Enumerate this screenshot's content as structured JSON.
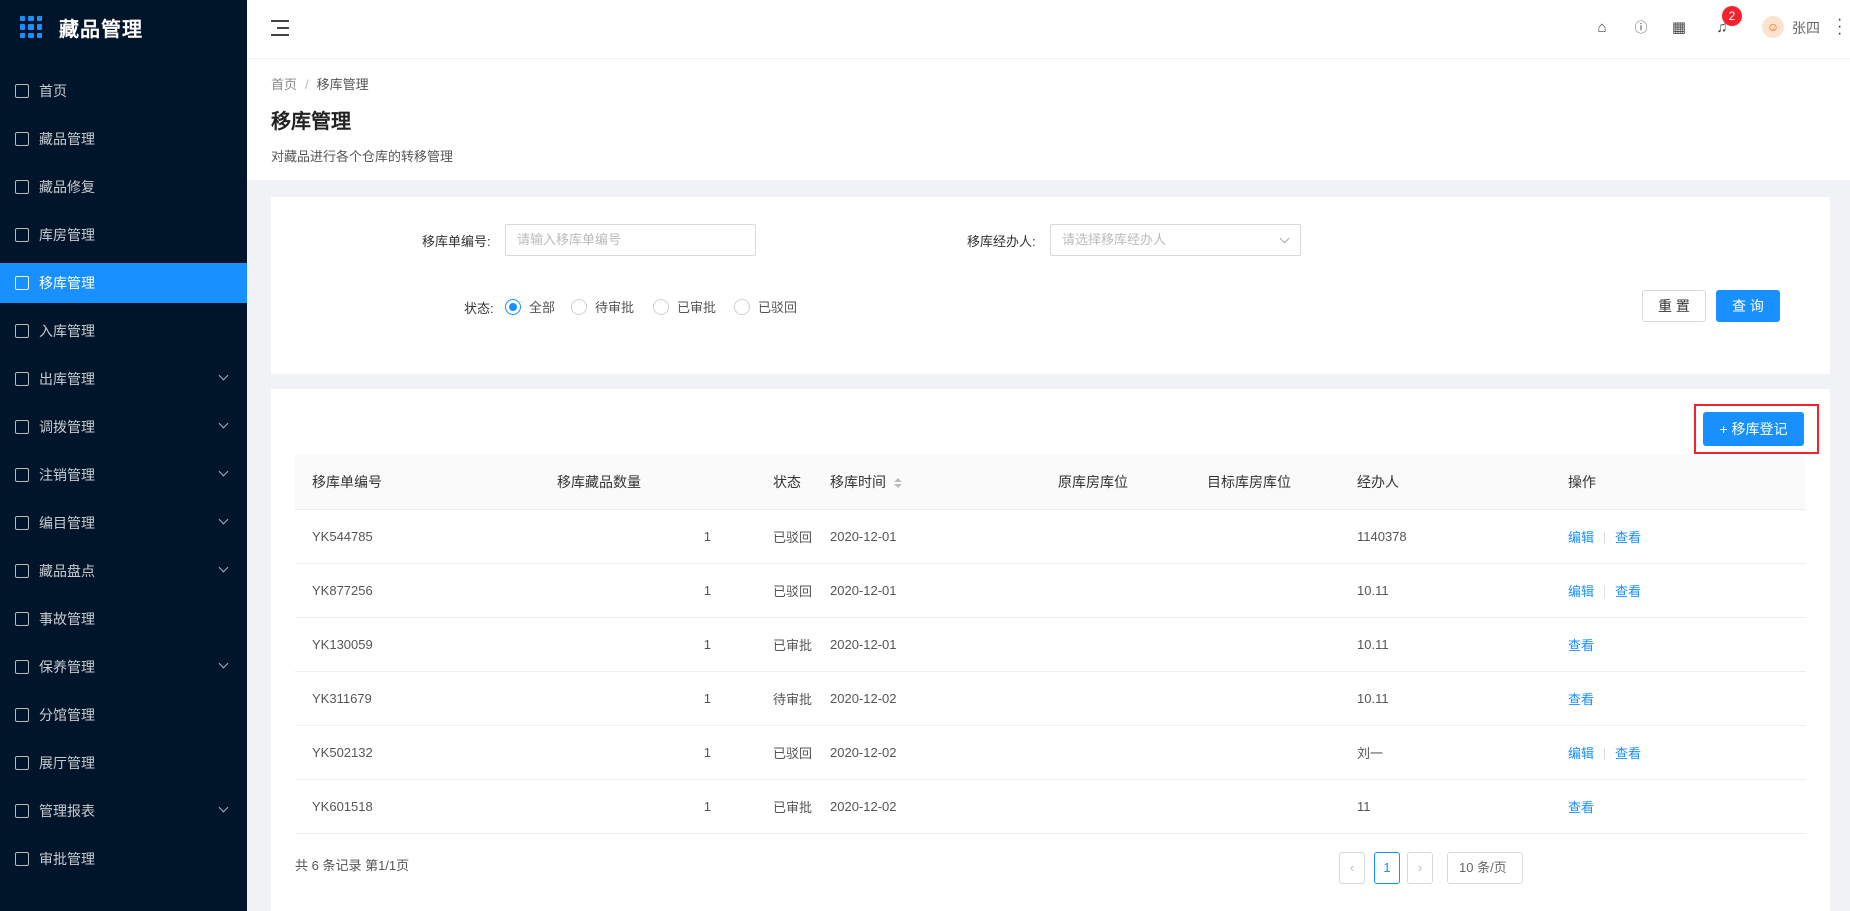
{
  "app": {
    "title": "藏品管理"
  },
  "sidebar": {
    "items": [
      {
        "label": "首页",
        "icon": "home-icon",
        "expandable": false,
        "active": false
      },
      {
        "label": "藏品管理",
        "icon": "calendar-icon",
        "expandable": false,
        "active": false
      },
      {
        "label": "藏品修复",
        "icon": "wrench-icon",
        "expandable": false,
        "active": false
      },
      {
        "label": "库房管理",
        "icon": "warehouse-icon",
        "expandable": false,
        "active": false
      },
      {
        "label": "移库管理",
        "icon": "transfer-icon",
        "expandable": false,
        "active": true
      },
      {
        "label": "入库管理",
        "icon": "cloud-upload-icon",
        "expandable": false,
        "active": false
      },
      {
        "label": "出库管理",
        "icon": "cloud-download-icon",
        "expandable": true,
        "active": false
      },
      {
        "label": "调拨管理",
        "icon": "swap-icon",
        "expandable": true,
        "active": false
      },
      {
        "label": "注销管理",
        "icon": "document-icon",
        "expandable": true,
        "active": false
      },
      {
        "label": "编目管理",
        "icon": "catalog-icon",
        "expandable": true,
        "active": false
      },
      {
        "label": "藏品盘点",
        "icon": "inventory-icon",
        "expandable": true,
        "active": false
      },
      {
        "label": "事故管理",
        "icon": "incident-icon",
        "expandable": false,
        "active": false
      },
      {
        "label": "保养管理",
        "icon": "maintenance-icon",
        "expandable": true,
        "active": false
      },
      {
        "label": "分馆管理",
        "icon": "branch-icon",
        "expandable": false,
        "active": false
      },
      {
        "label": "展厅管理",
        "icon": "laptop-icon",
        "expandable": false,
        "active": false
      },
      {
        "label": "管理报表",
        "icon": "report-icon",
        "expandable": true,
        "active": false
      },
      {
        "label": "审批管理",
        "icon": "approval-icon",
        "expandable": false,
        "active": false
      }
    ]
  },
  "header": {
    "notification_count": "2",
    "username": "张四"
  },
  "page": {
    "breadcrumb": [
      "首页",
      "移库管理"
    ],
    "title": "移库管理",
    "description": "对藏品进行各个仓库的转移管理"
  },
  "search": {
    "order_no_label": "移库单编号:",
    "order_no_placeholder": "请输入移库单编号",
    "handler_label": "移库经办人:",
    "handler_placeholder": "请选择移库经办人",
    "status_label": "状态:",
    "status_options": [
      "全部",
      "待审批",
      "已审批",
      "已驳回"
    ],
    "status_selected": "全部",
    "reset_label": "重 置",
    "query_label": "查 询"
  },
  "table": {
    "add_label": "+ 移库登记",
    "columns": [
      "移库单编号",
      "移库藏品数量",
      "状态",
      "移库时间",
      "原库房库位",
      "目标库房库位",
      "经办人",
      "操作"
    ],
    "rows": [
      {
        "no": "YK544785",
        "qty": "1",
        "status": "已驳回",
        "time": "2020-12-01",
        "from": "",
        "to": "",
        "handler": "1140378",
        "actions": [
          "编辑",
          "查看"
        ]
      },
      {
        "no": "YK877256",
        "qty": "1",
        "status": "已驳回",
        "time": "2020-12-01",
        "from": "",
        "to": "",
        "handler": "10.11",
        "actions": [
          "编辑",
          "查看"
        ]
      },
      {
        "no": "YK130059",
        "qty": "1",
        "status": "已审批",
        "time": "2020-12-01",
        "from": "",
        "to": "",
        "handler": "10.11",
        "actions": [
          "查看"
        ]
      },
      {
        "no": "YK311679",
        "qty": "1",
        "status": "待审批",
        "time": "2020-12-02",
        "from": "",
        "to": "",
        "handler": "10.11",
        "actions": [
          "查看"
        ]
      },
      {
        "no": "YK502132",
        "qty": "1",
        "status": "已驳回",
        "time": "2020-12-02",
        "from": "",
        "to": "",
        "handler": "刘一",
        "actions": [
          "编辑",
          "查看"
        ]
      },
      {
        "no": "YK601518",
        "qty": "1",
        "status": "已审批",
        "time": "2020-12-02",
        "from": "",
        "to": "",
        "handler": "11",
        "actions": [
          "查看"
        ]
      }
    ],
    "total_text": "共 6 条记录 第1/1页",
    "current_page": "1",
    "page_size_label": "10 条/页"
  },
  "colors": {
    "primary": "#1890ff",
    "sidebar_bg": "#001529",
    "highlight_border": "#f5222d"
  }
}
